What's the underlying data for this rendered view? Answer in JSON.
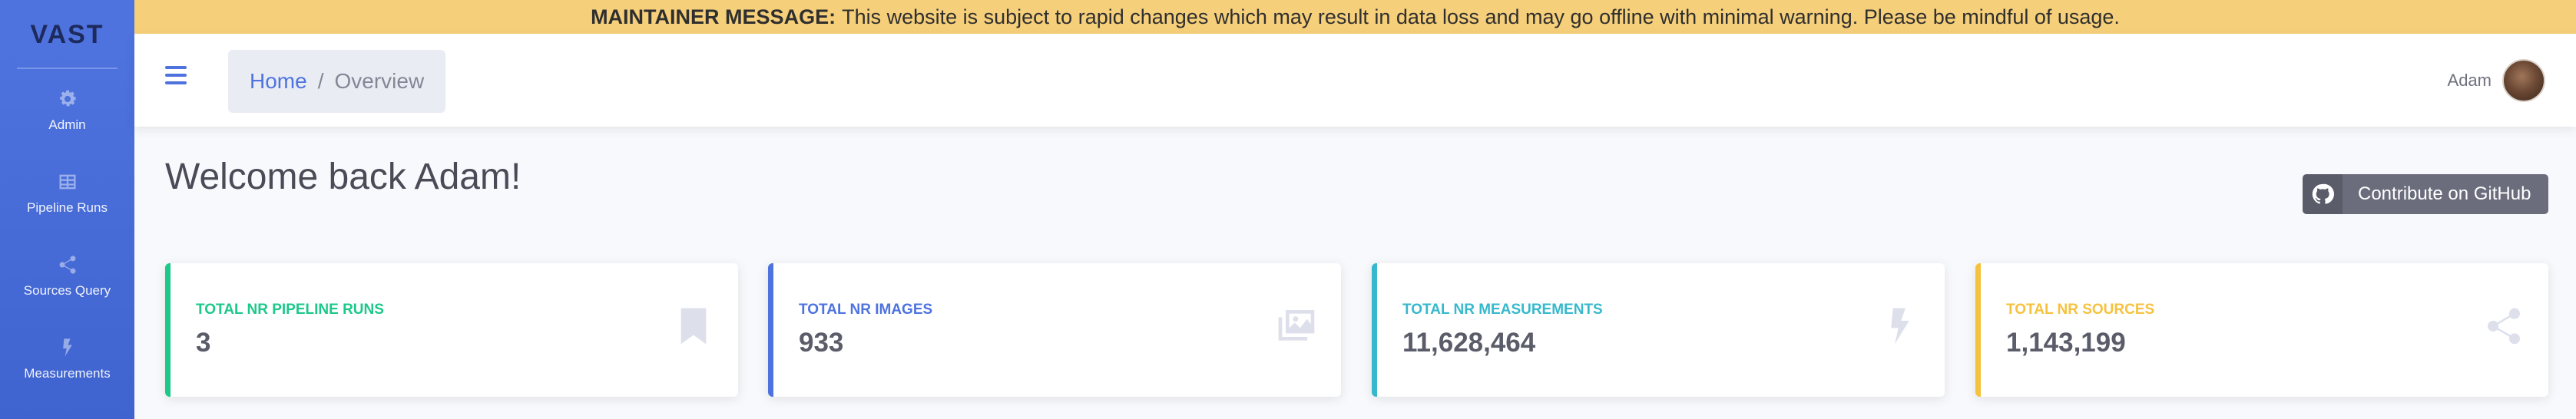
{
  "brand": {
    "name": "VAST"
  },
  "sidebar": {
    "items": [
      {
        "label": "Admin",
        "icon": "gear-icon"
      },
      {
        "label": "Pipeline Runs",
        "icon": "table-icon"
      },
      {
        "label": "Sources Query",
        "icon": "share-icon"
      },
      {
        "label": "Measurements",
        "icon": "bolt-icon"
      }
    ]
  },
  "banner": {
    "title": "MAINTAINER MESSAGE:",
    "text": "This website is subject to rapid changes which may result in data loss and may go offline with minimal warning. Please be mindful of usage."
  },
  "topbar": {
    "breadcrumb": {
      "home": "Home",
      "separator": "/",
      "current": "Overview"
    },
    "user": {
      "name": "Adam"
    }
  },
  "main": {
    "title": "Welcome back Adam!",
    "github_button": "Contribute on GitHub"
  },
  "cards": [
    {
      "label": "Total Nr Pipeline Runs",
      "value": "3",
      "color": "#1cc88a",
      "icon": "bookmark-icon"
    },
    {
      "label": "Total Nr Images",
      "value": "933",
      "color": "#4e73df",
      "icon": "images-icon"
    },
    {
      "label": "Total Nr Measurements",
      "value": "11,628,464",
      "color": "#36b9cc",
      "icon": "bolt-icon"
    },
    {
      "label": "Total Nr Sources",
      "value": "1,143,199",
      "color": "#f6c23e",
      "icon": "share-icon"
    }
  ],
  "colors": {
    "primary": "#4e73df",
    "banner": "#f6cf7a"
  }
}
